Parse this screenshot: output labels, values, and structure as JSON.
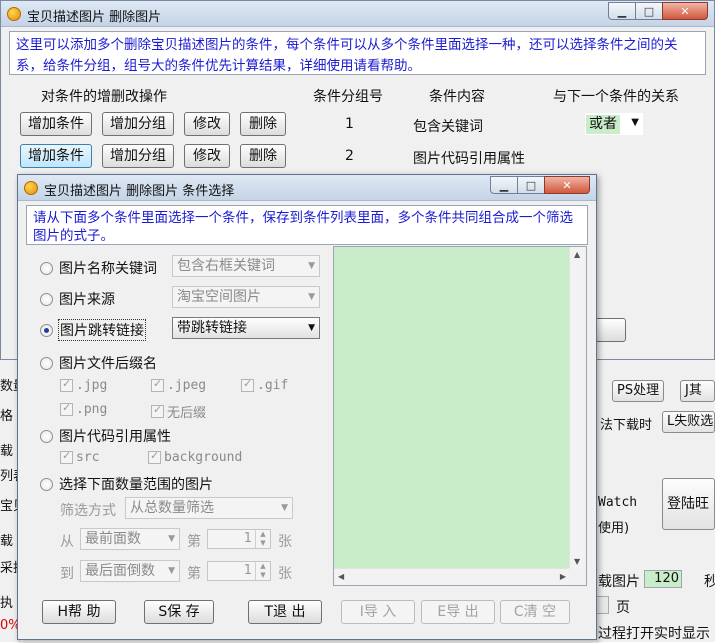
{
  "main_window": {
    "title": "宝贝描述图片 删除图片",
    "info": "这里可以添加多个删除宝贝描述图片的条件，每个条件可以从多个条件里面选择一种，还可以选择条件之间的关系，给条件分组，组号大的条件优先计算结果，详细使用请看帮助。",
    "headers": {
      "ops": "对条件的增删改操作",
      "group": "条件分组号",
      "content": "条件内容",
      "relation": "与下一个条件的关系"
    },
    "rows": [
      {
        "add": "增加条件",
        "add_group": "增加分组",
        "modify": "修改",
        "delete": "删除",
        "group": "1",
        "content": "包含关键词",
        "relation": "或者"
      },
      {
        "add": "增加条件",
        "add_group": "增加分组",
        "modify": "修改",
        "delete": "删除",
        "group": "2",
        "content": "图片代码引用属性",
        "relation": ""
      }
    ]
  },
  "background": {
    "left_fragments": [
      "数量",
      "格",
      "载",
      "列表",
      "宝贝",
      "载",
      "采执",
      "执",
      "0%"
    ],
    "right": {
      "ps_button": "PS处理",
      "j_button": "J其",
      "download_time": "法下载时",
      "fail_button": "L失败选",
      "watch": "Watch",
      "use": "使用)",
      "login_button": "登陆旺",
      "download_image": "载图片",
      "spin_value": "120",
      "spin_unit": "秒",
      "page": "页",
      "realtime": "过程打开实时显示"
    }
  },
  "dialog": {
    "title": "宝贝描述图片 删除图片 条件选择",
    "info": "请从下面多个条件里面选择一个条件，保存到条件列表里面，多个条件共同组合成一个筛选图片的式子。",
    "options": {
      "name_keyword": {
        "label": "图片名称关键词",
        "select": "包含右框关键词"
      },
      "source": {
        "label": "图片来源",
        "select": "淘宝空间图片"
      },
      "jump_link": {
        "label": "图片跳转链接",
        "select": "带跳转链接"
      },
      "suffix": {
        "label": "图片文件后缀名",
        "checks": [
          ".jpg",
          ".jpeg",
          ".gif",
          ".png",
          "无后缀"
        ]
      },
      "code_attr": {
        "label": "图片代码引用属性",
        "checks": [
          "src",
          "background"
        ]
      },
      "count_range": {
        "label": "选择下面数量范围的图片",
        "filter_label": "筛选方式",
        "filter_value": "从总数量筛选",
        "from_label": "从",
        "from_select": "最前面数",
        "to_label": "到",
        "to_select": "最后面倒数",
        "nth_label": "第",
        "unit": "张",
        "from_value": "1",
        "to_value": "1"
      }
    },
    "buttons": {
      "help": "H帮  助",
      "save": "S保  存",
      "exit": "T退  出",
      "import": "I导  入",
      "export": "E导  出",
      "clear": "C清  空"
    }
  },
  "colors": {
    "info_text": "#1b1bd0",
    "list_bg": "#c9ecc9",
    "titlebar": "#c4d3e6"
  }
}
